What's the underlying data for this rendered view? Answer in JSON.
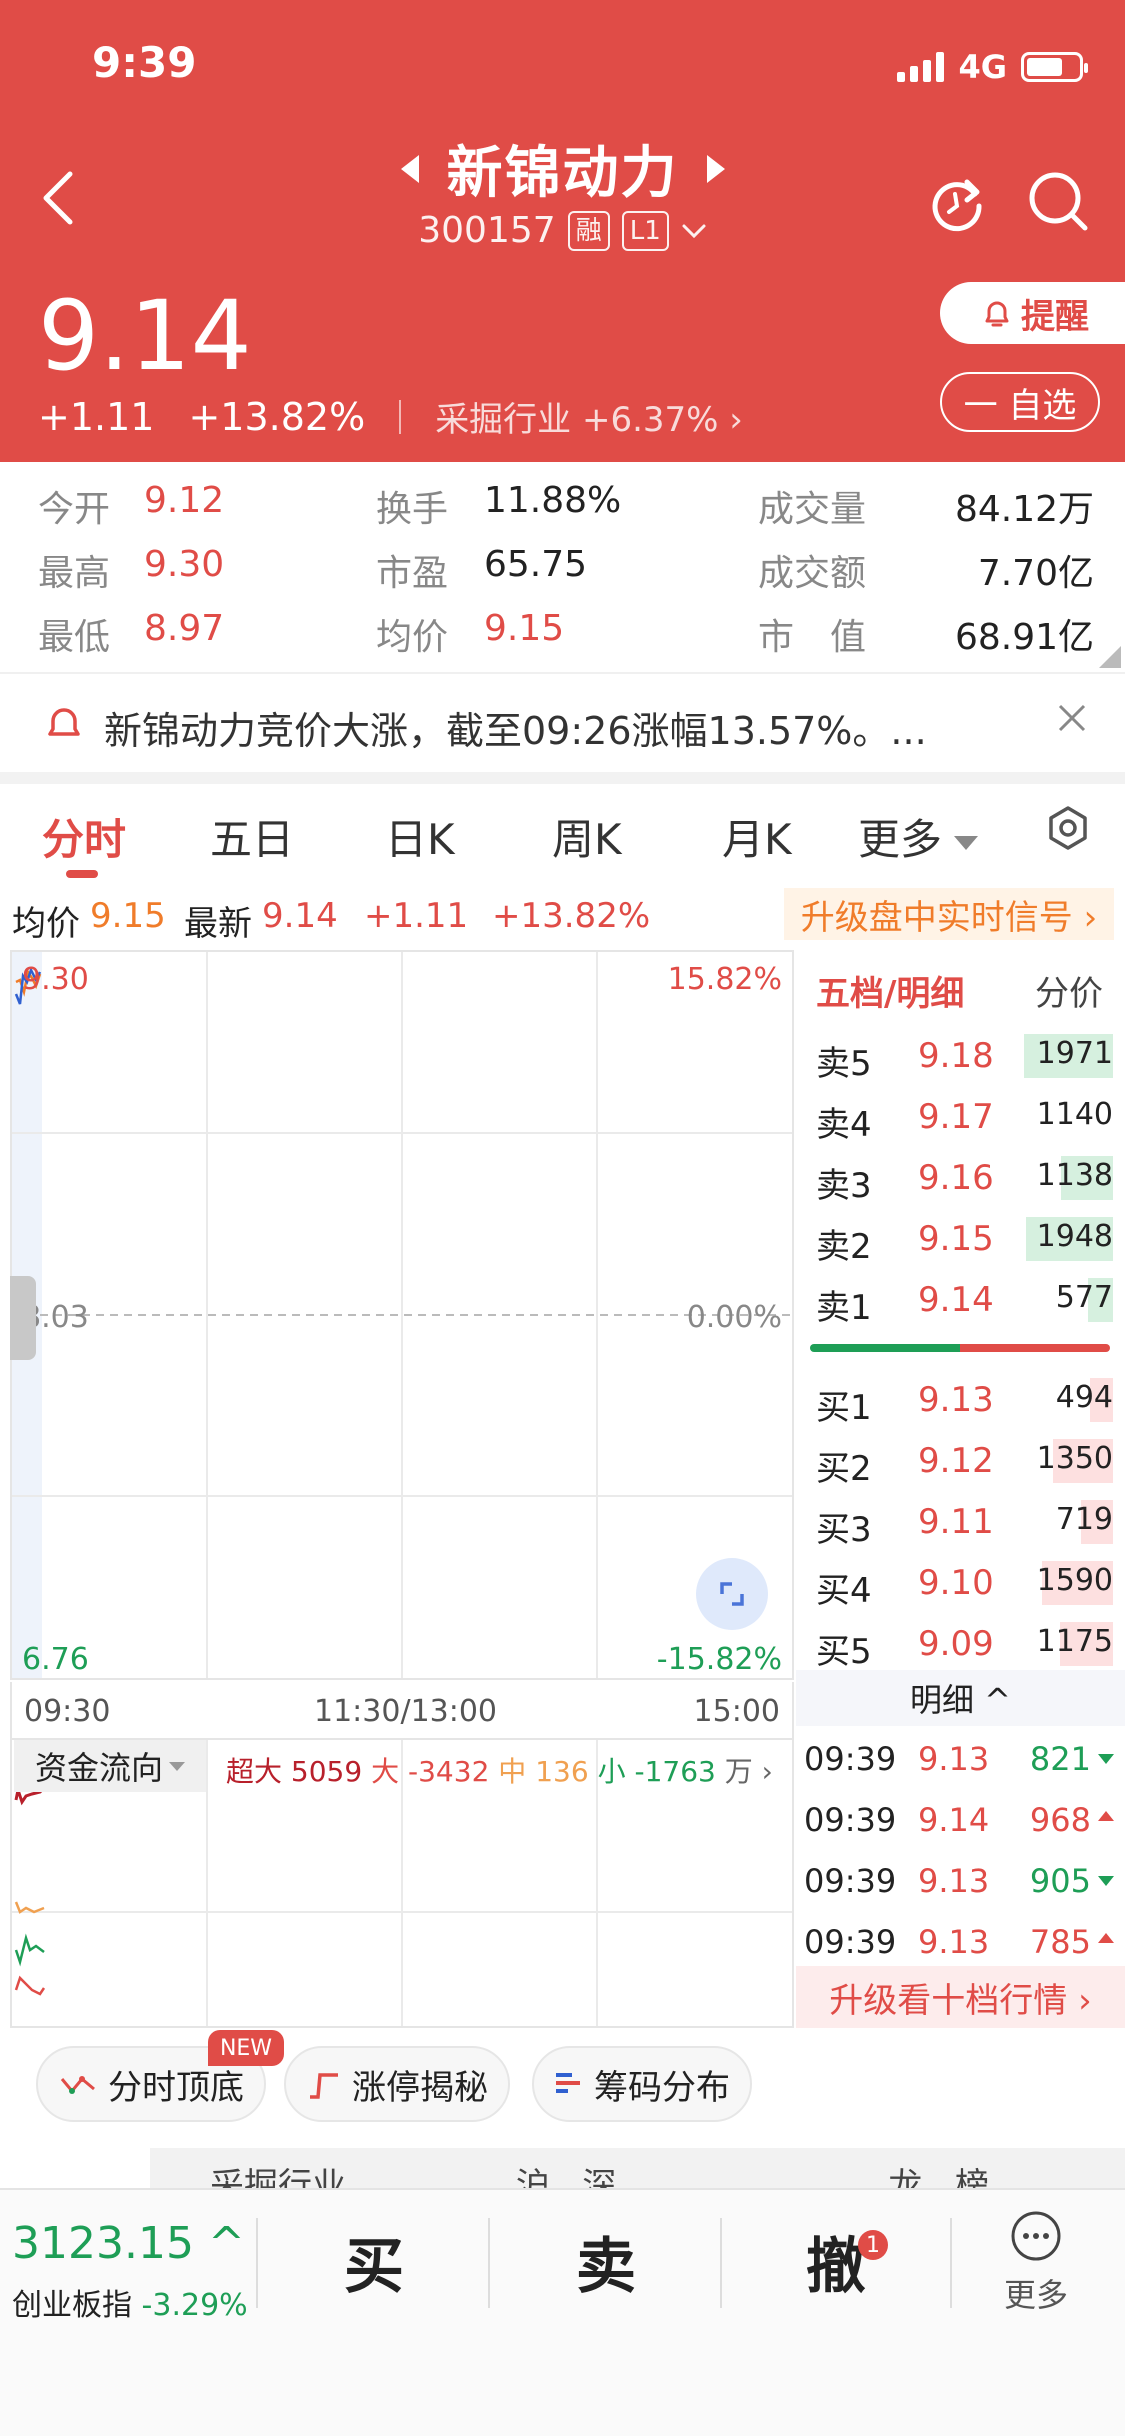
{
  "status": {
    "time": "9:39",
    "network": "4G"
  },
  "header": {
    "title": "新锦动力",
    "code": "300157",
    "tag_margin": "融",
    "tag_level": "L1",
    "price": "9.14",
    "change": "+1.11",
    "change_pct": "+13.82%",
    "industry": "采掘行业 +6.37%",
    "alert_label": "提醒",
    "watch_label": "一 自选"
  },
  "stats": [
    {
      "label": "今开",
      "value": "9.12"
    },
    {
      "label": "最高",
      "value": "9.30"
    },
    {
      "label": "最低",
      "value": "8.97"
    },
    {
      "label": "换手",
      "value": "11.88%"
    },
    {
      "label": "市盈",
      "value": "65.75"
    },
    {
      "label": "均价",
      "value": "9.15"
    },
    {
      "label": "成交量",
      "value": "84.12万"
    },
    {
      "label": "成交额",
      "value": "7.70亿"
    },
    {
      "label": "市　值",
      "value": "68.91亿"
    }
  ],
  "news": {
    "text": "新锦动力竞价大涨，截至09:26涨幅13.57%。..."
  },
  "tabs": [
    "分时",
    "五日",
    "日K",
    "周K",
    "月K",
    "更多"
  ],
  "info": {
    "avg_label": "均价",
    "avg_value": "9.15",
    "latest_label": "最新",
    "latest_value": "9.14",
    "change": "+1.11",
    "change_pct": "+13.82%",
    "upgrade": "升级盘中实时信号 ›"
  },
  "chart": {
    "high": "9.30",
    "mid": "8.03",
    "low": "6.76",
    "pct_high": "15.82%",
    "pct_mid": "0.00%",
    "pct_low": "-15.82%",
    "time_start": "09:30",
    "time_mid": "11:30/13:00",
    "time_end": "15:00"
  },
  "fund": {
    "tab": "资金流向",
    "xl_label": "超大",
    "xl_value": "5059",
    "l_label": "大",
    "l_value": "-3432",
    "m_label": "中",
    "m_value": "136",
    "s_label": "小",
    "s_value": "-1763",
    "unit": "万 ›"
  },
  "orderbook": {
    "title": "五档/明细",
    "title_right": "分价",
    "sells": [
      {
        "label": "卖5",
        "price": "9.18",
        "volume": "1971",
        "bar": 0.95
      },
      {
        "label": "卖4",
        "price": "9.17",
        "volume": "1140",
        "bar": 0.0
      },
      {
        "label": "卖3",
        "price": "9.16",
        "volume": "1138",
        "bar": 0.55
      },
      {
        "label": "卖2",
        "price": "9.15",
        "volume": "1948",
        "bar": 0.93
      },
      {
        "label": "卖1",
        "price": "9.14",
        "volume": "577",
        "bar": 0.27
      }
    ],
    "buys": [
      {
        "label": "买1",
        "price": "9.13",
        "volume": "494",
        "bar": 0.24
      },
      {
        "label": "买2",
        "price": "9.12",
        "volume": "1350",
        "bar": 0.64
      },
      {
        "label": "买3",
        "price": "9.11",
        "volume": "719",
        "bar": 0.34
      },
      {
        "label": "买4",
        "price": "9.10",
        "volume": "1590",
        "bar": 0.76
      },
      {
        "label": "买5",
        "price": "9.09",
        "volume": "1175",
        "bar": 0.56
      }
    ],
    "detail_label": "明细 ^",
    "ticks": [
      {
        "time": "09:39",
        "price": "9.13",
        "volume": "821",
        "dir": "down"
      },
      {
        "time": "09:39",
        "price": "9.14",
        "volume": "968",
        "dir": "up"
      },
      {
        "time": "09:39",
        "price": "9.13",
        "volume": "905",
        "dir": "down"
      },
      {
        "time": "09:39",
        "price": "9.13",
        "volume": "785",
        "dir": "up"
      }
    ],
    "upgrade10": "升级看十档行情 ›"
  },
  "chips": {
    "c1": "分时顶底",
    "c2": "涨停揭秘",
    "c3": "筹码分布",
    "new_badge": "NEW"
  },
  "peek": {
    "text": "采掘行业　　　　　沪...深　　　　　　　　龙...榜..."
  },
  "bottom": {
    "index_value": "3123.15 ^",
    "index_name": "创业板指",
    "index_change": "-3.29%",
    "buy": "买",
    "sell": "卖",
    "cancel": "撤",
    "cancel_badge": "1",
    "more": "更多"
  },
  "colors": {
    "header_red": "#e04c47",
    "up_red": "#e04c47",
    "down_green": "#1e9e56",
    "orange": "#f07c2a"
  }
}
